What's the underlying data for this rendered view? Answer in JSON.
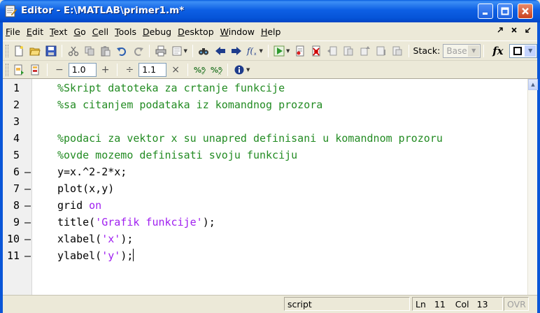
{
  "window": {
    "title": "Editor - E:\\MATLAB\\primer1.m*",
    "icon": "matlab-editor-icon"
  },
  "menubar": {
    "items": [
      {
        "label": "File",
        "key": "F",
        "rest": "ile"
      },
      {
        "label": "Edit",
        "key": "E",
        "rest": "dit"
      },
      {
        "label": "Text",
        "key": "T",
        "rest": "ext"
      },
      {
        "label": "Go",
        "key": "G",
        "rest": "o"
      },
      {
        "label": "Cell",
        "key": "C",
        "rest": "ell"
      },
      {
        "label": "Tools",
        "key": "T",
        "rest": "ools"
      },
      {
        "label": "Debug",
        "key": "D",
        "rest": "ebug"
      },
      {
        "label": "Desktop",
        "key": "D",
        "rest": "esktop"
      },
      {
        "label": "Window",
        "key": "W",
        "rest": "indow"
      },
      {
        "label": "Help",
        "key": "H",
        "rest": "elp"
      }
    ],
    "right_icons": [
      "undock-icon",
      "close-doc-icon",
      "dock-icon"
    ]
  },
  "toolbar1": {
    "stack_label": "Stack:",
    "stack_value": "Base",
    "fx_label": "fx"
  },
  "toolbar2": {
    "minus_symbol": "−",
    "cell_value_1": "1.0",
    "plus_symbol": "+",
    "divide_symbol": "÷",
    "cell_value_2": "1.1",
    "times_symbol": "×"
  },
  "editor": {
    "lines": [
      {
        "num": "1",
        "dash": "",
        "segments": [
          {
            "t": "%Skript datoteka za crtanje funkcije",
            "c": "comment"
          }
        ]
      },
      {
        "num": "2",
        "dash": "",
        "segments": [
          {
            "t": "%sa citanjem podataka iz komandnog prozora",
            "c": "comment"
          }
        ]
      },
      {
        "num": "3",
        "dash": "",
        "segments": []
      },
      {
        "num": "4",
        "dash": "",
        "segments": [
          {
            "t": "%podaci za vektor x su unapred definisani u komandnom prozoru",
            "c": "comment"
          }
        ]
      },
      {
        "num": "5",
        "dash": "",
        "segments": [
          {
            "t": "%ovde mozemo definisati svoju funkciju",
            "c": "comment"
          }
        ]
      },
      {
        "num": "6",
        "dash": "—",
        "segments": [
          {
            "t": "y=x.^2-2*x;",
            "c": ""
          }
        ]
      },
      {
        "num": "7",
        "dash": "—",
        "segments": [
          {
            "t": "plot(x,y)",
            "c": ""
          }
        ]
      },
      {
        "num": "8",
        "dash": "—",
        "segments": [
          {
            "t": "grid ",
            "c": ""
          },
          {
            "t": "on",
            "c": "keyword"
          }
        ]
      },
      {
        "num": "9",
        "dash": "—",
        "segments": [
          {
            "t": "title(",
            "c": ""
          },
          {
            "t": "'Grafik funkcije'",
            "c": "string"
          },
          {
            "t": ");",
            "c": ""
          }
        ]
      },
      {
        "num": "10",
        "dash": "—",
        "segments": [
          {
            "t": "xlabel(",
            "c": ""
          },
          {
            "t": "'x'",
            "c": "string"
          },
          {
            "t": ");",
            "c": ""
          }
        ]
      },
      {
        "num": "11",
        "dash": "—",
        "segments": [
          {
            "t": "ylabel(",
            "c": ""
          },
          {
            "t": "'y'",
            "c": "string"
          },
          {
            "t": ");",
            "c": ""
          }
        ]
      }
    ]
  },
  "statusbar": {
    "mode": "script",
    "ln_label": "Ln",
    "ln_value": "11",
    "col_label": "Col",
    "col_value": "13",
    "ovr": "OVR"
  },
  "colors": {
    "comment": "#228b22",
    "string": "#a020f0",
    "titlebar": "#0a5fe0"
  }
}
